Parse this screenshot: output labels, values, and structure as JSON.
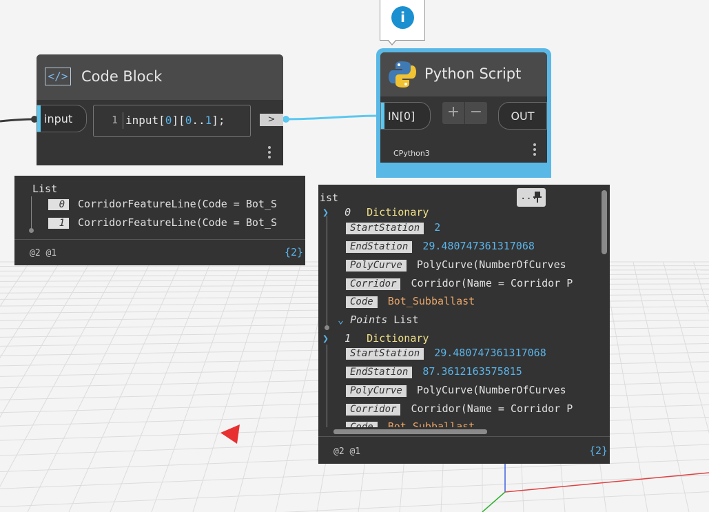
{
  "code_block": {
    "title": "Code Block",
    "icon": "code-icon",
    "input_port": "input",
    "line_number": "1",
    "code_parts": [
      "input[",
      "0",
      "][",
      "0",
      "..",
      "1",
      "];"
    ],
    "output_port": ">"
  },
  "python_node": {
    "title": "Python Script",
    "icon": "python-icon",
    "input_port": "IN[0]",
    "add_label": "+",
    "remove_label": "−",
    "output_port": "OUT",
    "engine": "CPython3",
    "info_icon": "info-icon",
    "info_glyph": "i"
  },
  "watch_left": {
    "header": "List",
    "items": [
      {
        "index": "0",
        "value": "CorridorFeatureLine(Code = Bot_S"
      },
      {
        "index": "1",
        "value": "CorridorFeatureLine(Code = Bot_S"
      }
    ],
    "levels": "@2 @1",
    "count": "{2}"
  },
  "watch_right": {
    "header": "ist",
    "menu_label": "...",
    "pin_icon": "pin-icon",
    "dictionaries": [
      {
        "index": "0",
        "label": "Dictionary",
        "entries": [
          {
            "key": "StartStation",
            "value": "2",
            "kind": "num"
          },
          {
            "key": "EndStation",
            "value": "29.480747361317068",
            "kind": "num"
          },
          {
            "key": "PolyCurve",
            "value": "PolyCurve(NumberOfCurves",
            "kind": "val"
          },
          {
            "key": "Corridor",
            "value": "Corridor(Name = Corridor P",
            "kind": "val"
          },
          {
            "key": "Code",
            "value": "Bot_Subballast",
            "kind": "str"
          }
        ],
        "points_key": "Points",
        "points_value": "List"
      },
      {
        "index": "1",
        "label": "Dictionary",
        "entries": [
          {
            "key": "StartStation",
            "value": "29.480747361317068",
            "kind": "num"
          },
          {
            "key": "EndStation",
            "value": "87.3612163575815",
            "kind": "num"
          },
          {
            "key": "PolyCurve",
            "value": "PolyCurve(NumberOfCurves",
            "kind": "val"
          },
          {
            "key": "Corridor",
            "value": "Corridor(Name = Corridor P",
            "kind": "val"
          },
          {
            "key": "Code",
            "value": "Bot_Subballast",
            "kind": "str"
          }
        ]
      }
    ],
    "levels": "@2 @1",
    "count": "{2}"
  },
  "colors": {
    "accent_blue": "#5ac8f0",
    "node_body": "#353535",
    "node_header": "#4a4a4a",
    "number": "#5ab4ea",
    "string": "#e8a468",
    "dictionary": "#f0e08a",
    "cursor_red": "#e83030"
  }
}
